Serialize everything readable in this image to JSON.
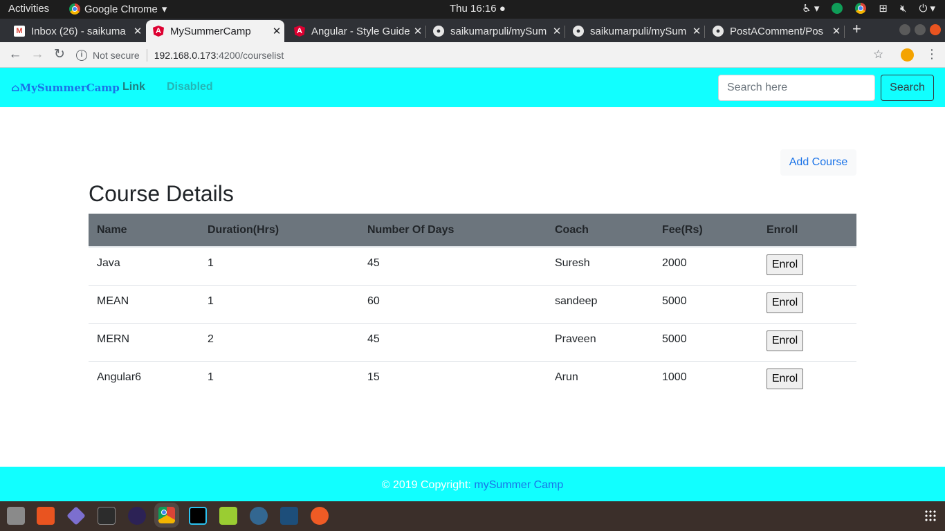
{
  "system": {
    "activities": "Activities",
    "app_name": "Google Chrome",
    "clock": "Thu 16:16"
  },
  "tabs": [
    {
      "title": "Inbox (26) - saikuma",
      "icon": "gmail-icon",
      "color": "#db4437"
    },
    {
      "title": "MySummerCamp",
      "icon": "angular-icon",
      "color": "#dd0031",
      "active": true
    },
    {
      "title": "Angular - Style Guide",
      "icon": "angular-icon",
      "color": "#dd0031"
    },
    {
      "title": "saikumarpuli/mySum",
      "icon": "github-icon",
      "color": "#24292e"
    },
    {
      "title": "saikumarpuli/mySum",
      "icon": "github-icon",
      "color": "#24292e"
    },
    {
      "title": "PostAComment/Pos",
      "icon": "github-icon",
      "color": "#24292e"
    }
  ],
  "address": {
    "security": "Not secure",
    "host": "192.168.0.173",
    "path": ":4200/courselist"
  },
  "navbar": {
    "brand": "MySummerCamp",
    "link": "Link",
    "disabled": "Disabled",
    "search_placeholder": "Search here",
    "search_button": "Search"
  },
  "main": {
    "add_course": "Add Course",
    "title": "Course Details",
    "columns": [
      "Name",
      "Duration(Hrs)",
      "Number Of Days",
      "Coach",
      "Fee(Rs)",
      "Enroll"
    ],
    "enrol_label": "Enrol",
    "rows": [
      {
        "name": "Java",
        "duration": "1",
        "days": "45",
        "coach": "Suresh",
        "fee": "2000"
      },
      {
        "name": "MEAN",
        "duration": "1",
        "days": "60",
        "coach": "sandeep",
        "fee": "5000"
      },
      {
        "name": "MERN",
        "duration": "2",
        "days": "45",
        "coach": "Praveen",
        "fee": "5000"
      },
      {
        "name": "Angular6",
        "duration": "1",
        "days": "15",
        "coach": "Arun",
        "fee": "1000"
      }
    ]
  },
  "footer": {
    "copyright": "© 2019 Copyright:",
    "link": "mySummer Camp"
  },
  "colors": {
    "navbar_bg": "#11ffff",
    "link_active": "#1a73e8",
    "link_muted": "#24b5b5",
    "table_header": "#6c757d"
  },
  "dock": [
    "files-icon",
    "software-icon",
    "app-icon",
    "terminal-icon",
    "eclipse-icon",
    "chrome-icon",
    "webstorm-icon",
    "image-viewer-icon",
    "pgadmin-icon",
    "mysql-workbench-icon",
    "postman-icon"
  ]
}
